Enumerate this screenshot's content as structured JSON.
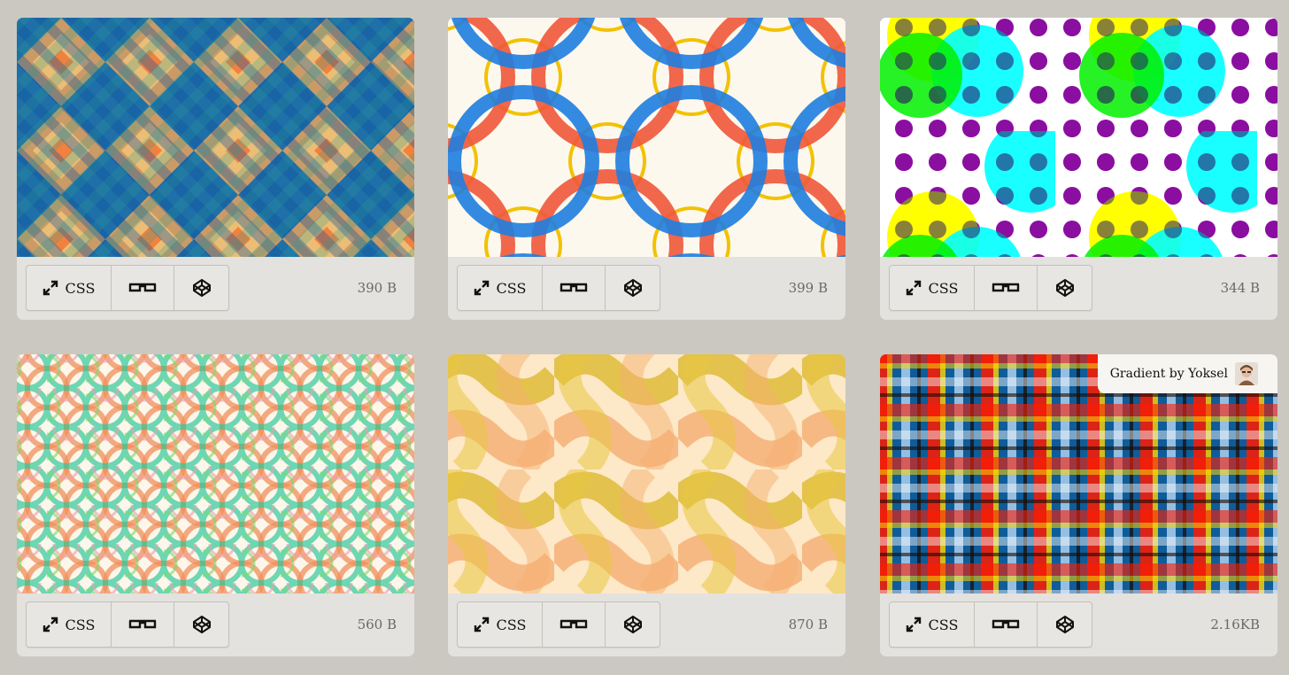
{
  "cards": [
    {
      "css_label": "CSS",
      "size": "390 B"
    },
    {
      "css_label": "CSS",
      "size": "399 B"
    },
    {
      "css_label": "CSS",
      "size": "344 B"
    },
    {
      "css_label": "CSS",
      "size": "560 B"
    },
    {
      "css_label": "CSS",
      "size": "870 B"
    },
    {
      "css_label": "CSS",
      "size": "2.16KB",
      "credit": "Gradient by Yoksel"
    }
  ],
  "colors": {
    "page_bg": "#cbc8c2",
    "card_bg": "#e4e2de",
    "size_text": "#6b6966"
  },
  "icons": [
    "expand-icon",
    "glasses-icon",
    "codepen-icon"
  ]
}
